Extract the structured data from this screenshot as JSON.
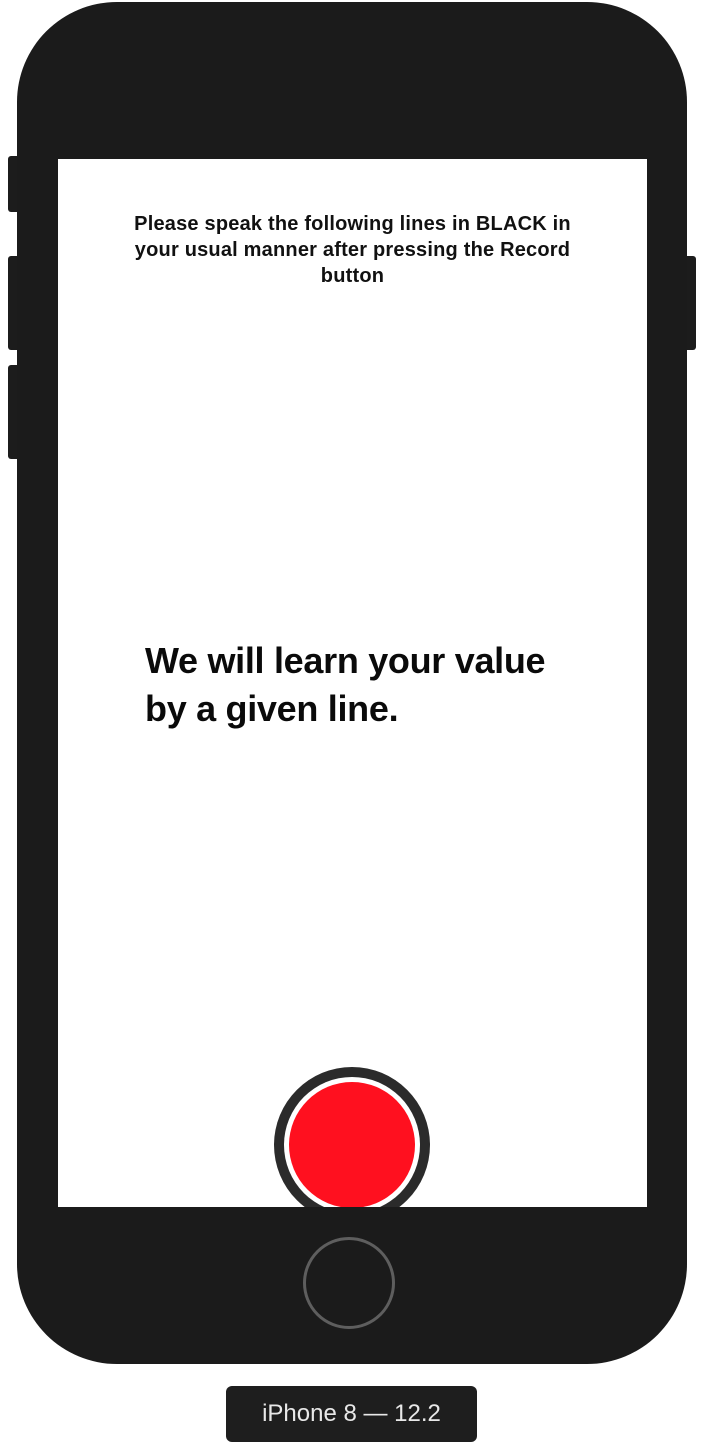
{
  "screen": {
    "instruction": "Please speak the following lines in BLACK in your usual manner after pressing the Record button",
    "prompt_line": "We will learn your value by a given line.",
    "record_button": {
      "accessibility_name": "Record",
      "color": "#ff101f"
    }
  },
  "simulator": {
    "device_label": "iPhone 8 — 12.2"
  }
}
